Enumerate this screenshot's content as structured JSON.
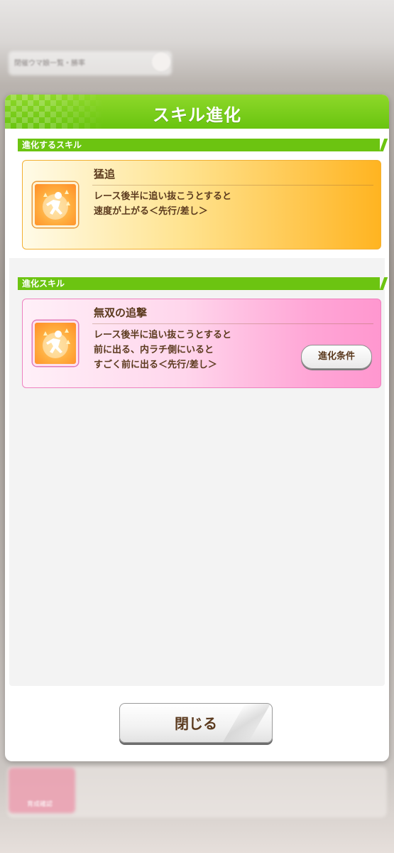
{
  "background": {
    "top_bar_text": "閉催ウマ娘一覧・勝率",
    "nav_active_label": "育成確認"
  },
  "dialog": {
    "title": "スキル進化",
    "section_before_label": "進化するスキル",
    "section_after_label": "進化スキル",
    "skill_before": {
      "name": "猛追",
      "description": "レース後半に追い抜こうとすると\n速度が上がる＜先行/差し＞",
      "icon": "running-figure-icon"
    },
    "skill_after": {
      "name": "無双の追撃",
      "description": "レース後半に追い抜こうとすると\n前に出る、内ラチ側にいると\nすごく前に出る＜先行/差し＞",
      "icon": "running-figure-icon",
      "condition_button_label": "進化条件"
    },
    "close_button_label": "閉じる"
  },
  "colors": {
    "header_green": "#6cc411",
    "card_gold": "#ffc54a",
    "card_pink": "#ffa6d6",
    "text_brown": "#5b3a1e"
  }
}
